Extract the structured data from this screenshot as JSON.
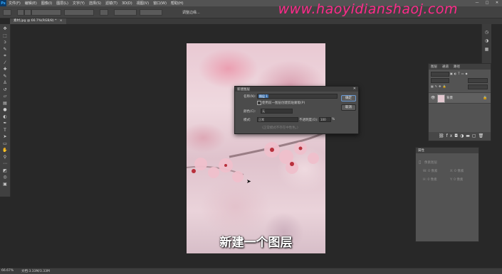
{
  "menubar": {
    "logo": "Ps",
    "items": [
      "文件(F)",
      "编辑(E)",
      "图像(I)",
      "图层(L)",
      "文字(Y)",
      "选择(S)",
      "滤镜(T)",
      "3D(D)",
      "视图(V)",
      "窗口(W)",
      "帮助(H)"
    ],
    "window_controls": [
      "—",
      "□",
      "✕"
    ]
  },
  "options": {
    "feather_value": "0 像素",
    "refine_edge_label": "调整边缘..."
  },
  "watermark": "www.haoyidianshaoj.com",
  "document_tab": {
    "label": "素材.jpg @ 66.7%(RGB/8) *",
    "close": "×"
  },
  "tools": [
    {
      "icon": "move-icon",
      "glyph": "✥"
    },
    {
      "icon": "marquee-icon",
      "glyph": "⬚"
    },
    {
      "icon": "lasso-icon",
      "glyph": "ↄ"
    },
    {
      "icon": "quick-select-icon",
      "glyph": "✎"
    },
    {
      "icon": "crop-icon",
      "glyph": "⌗"
    },
    {
      "icon": "eyedropper-icon",
      "glyph": "⁄"
    },
    {
      "icon": "healing-brush-icon",
      "glyph": "✚"
    },
    {
      "icon": "brush-icon",
      "glyph": "✎"
    },
    {
      "icon": "clone-stamp-icon",
      "glyph": "♙"
    },
    {
      "icon": "history-brush-icon",
      "glyph": "↺"
    },
    {
      "icon": "eraser-icon",
      "glyph": "▱"
    },
    {
      "icon": "gradient-icon",
      "glyph": "▤"
    },
    {
      "icon": "blur-icon",
      "glyph": "●"
    },
    {
      "icon": "dodge-icon",
      "glyph": "◐"
    },
    {
      "icon": "pen-icon",
      "glyph": "✒"
    },
    {
      "icon": "type-icon",
      "glyph": "T"
    },
    {
      "icon": "path-select-icon",
      "glyph": "➤"
    },
    {
      "icon": "shape-icon",
      "glyph": "▭"
    },
    {
      "icon": "hand-icon",
      "glyph": "✋"
    },
    {
      "icon": "zoom-icon",
      "glyph": "⚲"
    },
    {
      "icon": "more-tools-icon",
      "glyph": "⋯"
    },
    {
      "icon": "color-swatches-icon",
      "glyph": "◩"
    },
    {
      "icon": "quick-mask-icon",
      "glyph": "◎"
    },
    {
      "icon": "screen-mode-icon",
      "glyph": "▣"
    }
  ],
  "caption": "新建一个图层",
  "dialog": {
    "title": "新建图层",
    "close": "✕",
    "name_label": "名称(N):",
    "name_value": "图层 1",
    "clip_checkbox_label": "使用前一图层创建剪贴蒙版(P)",
    "color_label": "颜色(C):",
    "color_value": "无",
    "mode_label": "模式:",
    "mode_value": "正常",
    "opacity_label": "不透明度(O):",
    "opacity_value": "100",
    "opacity_unit": "%",
    "neutral_label": "(正常模式不存在中性色。)",
    "ok_label": "确定",
    "cancel_label": "取消"
  },
  "layers_panel": {
    "tabs": [
      "图层",
      "通道",
      "路径"
    ],
    "layer_name": "背景",
    "eye": "👁",
    "lock": "🔒",
    "footer_icons": [
      "link-icon",
      "fx-icon",
      "mask-icon",
      "adjustment-icon",
      "folder-icon",
      "new-layer-icon",
      "delete-icon"
    ]
  },
  "properties_panel": {
    "title": "属性",
    "subtitle": "像素图层",
    "rows": [
      "W: 0 像素",
      "X: 0 像素",
      "H: 0 像素",
      "Y: 0 像素"
    ]
  },
  "statusbar": {
    "zoom": "66.67%",
    "doc": "文档:3.33M/3.33M"
  }
}
